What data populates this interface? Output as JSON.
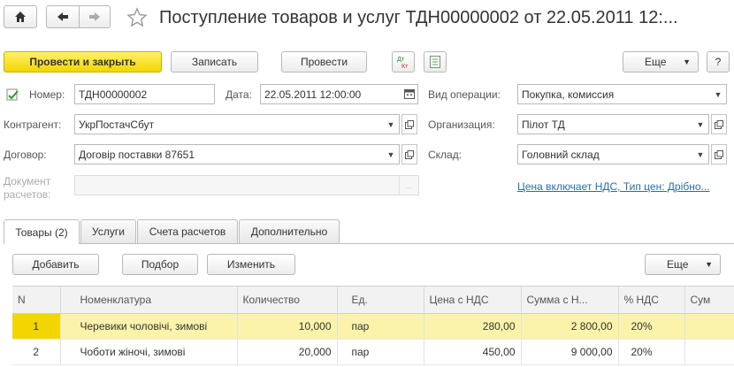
{
  "window": {
    "title": "Поступление товаров и услуг ТДН00000002 от 22.05.2011 12:..."
  },
  "toolbar": {
    "post_close": "Провести и закрыть",
    "save": "Записать",
    "post": "Провести",
    "more": "Еще",
    "help": "?"
  },
  "form": {
    "number_label": "Номер:",
    "number_value": "ТДН00000002",
    "date_label": "Дата:",
    "date_value": "22.05.2011 12:00:00",
    "operation_label": "Вид операции:",
    "operation_value": "Покупка, комиссия",
    "counterparty_label": "Контрагент:",
    "counterparty_value": "УкрПостачСбут",
    "organization_label": "Организация:",
    "organization_value": "Пілот ТД",
    "contract_label": "Договор:",
    "contract_value": "Договір поставки 87651",
    "warehouse_label": "Склад:",
    "warehouse_value": "Головний склад",
    "settlement_doc_label_1": "Документ",
    "settlement_doc_label_2": "расчетов:",
    "settlement_doc_value": "",
    "settlement_doc_dots": "...",
    "price_link": "Цена включает НДС, Тип цен: Дрібно..."
  },
  "tabs": [
    {
      "label": "Товары (2)"
    },
    {
      "label": "Услуги"
    },
    {
      "label": "Счета расчетов"
    },
    {
      "label": "Дополнительно"
    }
  ],
  "table_toolbar": {
    "add": "Добавить",
    "select": "Подбор",
    "change": "Изменить",
    "more": "Еще"
  },
  "table": {
    "headers": [
      "N",
      "Номенклатура",
      "Количество",
      "Ед.",
      "Цена с НДС",
      "Сумма с Н...",
      "% НДС",
      "Сум"
    ],
    "rows": [
      [
        "1",
        "Черевики чоловічі, зимові",
        "10,000",
        "пар",
        "280,00",
        "2 800,00",
        "20%",
        ""
      ],
      [
        "2",
        "Чоботи  жіночі, зимові",
        "20,000",
        "пар",
        "450,00",
        "9 000,00",
        "20%",
        ""
      ]
    ]
  },
  "colors": {
    "primary_button": "#f3d500",
    "selected_row": "#fbf3a9",
    "link": "#2a6ea8"
  }
}
